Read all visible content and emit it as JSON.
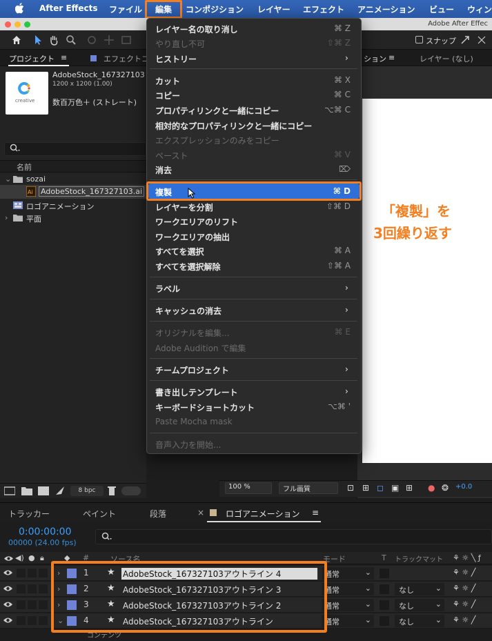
{
  "menubar": {
    "app_name": "After Effects",
    "items": [
      "ファイル",
      "編集",
      "コンポジション",
      "レイヤー",
      "エフェクト",
      "アニメーション",
      "ビュー",
      "ウィン"
    ]
  },
  "window": {
    "title": "Adobe After Effec"
  },
  "toolbar": {
    "snap_label": "スナップ"
  },
  "project_panel": {
    "tab_project": "プロジェクト",
    "tab_effect": "エフェクトコ",
    "tab_comp": "ション",
    "tab_layer": "レイヤー (なし)",
    "selected_file": "AdobeStock_167327103",
    "dimensions": "1200 x 1200 (1.00)",
    "color_info": "数百万色＋ (ストレート)",
    "thumbnail_text": "creative",
    "col_name": "名前",
    "items": [
      "sozai",
      "AdobeStock_167327103.ai",
      "ロゴアニメーション",
      "平面"
    ],
    "bpc": "8 bpc"
  },
  "comp_bar": {
    "zoom": "100 %",
    "quality": "フル画質",
    "exposure": "+0.0"
  },
  "edit_menu": {
    "groups": [
      [
        {
          "label": "レイヤー名の取り消し",
          "shortcut": "⌘ Z",
          "disabled": false
        },
        {
          "label": "やり直し不可",
          "shortcut": "⇧⌘ Z",
          "disabled": true
        },
        {
          "label": "ヒストリー",
          "shortcut": "",
          "disabled": false,
          "submenu": true
        }
      ],
      [
        {
          "label": "カット",
          "shortcut": "⌘ X",
          "disabled": false
        },
        {
          "label": "コピー",
          "shortcut": "⌘ C",
          "disabled": false
        },
        {
          "label": "プロパティリンクと一緒にコピー",
          "shortcut": "⌥⌘ C",
          "disabled": false
        },
        {
          "label": "相対的なプロパティリンクと一緒にコピー",
          "shortcut": "",
          "disabled": false
        },
        {
          "label": "エクスプレッションのみをコピー",
          "shortcut": "",
          "disabled": true
        },
        {
          "label": "ペースト",
          "shortcut": "⌘ V",
          "disabled": true
        },
        {
          "label": "消去",
          "shortcut": "⌦",
          "disabled": false
        }
      ],
      [
        {
          "label": "複製",
          "shortcut": "⌘ D",
          "disabled": false,
          "highlighted": true
        },
        {
          "label": "レイヤーを分割",
          "shortcut": "⇧⌘ D",
          "disabled": false
        },
        {
          "label": "ワークエリアのリフト",
          "shortcut": "",
          "disabled": false
        },
        {
          "label": "ワークエリアの抽出",
          "shortcut": "",
          "disabled": false
        },
        {
          "label": "すべてを選択",
          "shortcut": "⌘ A",
          "disabled": false
        },
        {
          "label": "すべてを選択解除",
          "shortcut": "⇧⌘ A",
          "disabled": false
        }
      ],
      [
        {
          "label": "ラベル",
          "shortcut": "",
          "disabled": false,
          "submenu": true
        }
      ],
      [
        {
          "label": "キャッシュの消去",
          "shortcut": "",
          "disabled": false,
          "submenu": true
        }
      ],
      [
        {
          "label": "オリジナルを編集...",
          "shortcut": "⌘ E",
          "disabled": true
        },
        {
          "label": "Adobe Audition で編集",
          "shortcut": "",
          "disabled": true
        }
      ],
      [
        {
          "label": "チームプロジェクト",
          "shortcut": "",
          "disabled": false,
          "submenu": true
        }
      ],
      [
        {
          "label": "書き出しテンプレート",
          "shortcut": "",
          "disabled": false,
          "submenu": true
        },
        {
          "label": "キーボードショートカット",
          "shortcut": "⌥⌘ '",
          "disabled": false
        },
        {
          "label": "Paste Mocha mask",
          "shortcut": "",
          "disabled": true
        }
      ],
      [
        {
          "label": "音声入力を開始...",
          "shortcut": "",
          "disabled": true
        }
      ]
    ]
  },
  "annotation": {
    "line1": "「複製」を",
    "line2": "3回繰り返す"
  },
  "timeline": {
    "tabs": [
      "トラッカー",
      "ペイント",
      "段落",
      "ロゴアニメーション"
    ],
    "timecode": "0:00:00:00",
    "fps": "00000 (24.00 fps)",
    "col_source": "ソース名",
    "col_mode": "モード",
    "col_t": "T",
    "col_trackmatte": "トラックマット",
    "col_num": "#",
    "layers": [
      {
        "num": "1",
        "name": "AdobeStock_167327103アウトライン 4",
        "mode": "通常",
        "matte": "",
        "expanded": false
      },
      {
        "num": "2",
        "name": "AdobeStock_167327103アウトライン 3",
        "mode": "通常",
        "matte": "なし",
        "expanded": false
      },
      {
        "num": "3",
        "name": "AdobeStock_167327103アウトライン 2",
        "mode": "通常",
        "matte": "なし",
        "expanded": false
      },
      {
        "num": "4",
        "name": "AdobeStock_167327103アウトライン",
        "mode": "通常",
        "matte": "なし",
        "expanded": true
      }
    ],
    "contents_label": "コンテンツ"
  },
  "colors": {
    "accent_orange": "#f47f20",
    "menu_highlight": "#2f6fd8",
    "menubar_blue": "#2a58a6",
    "label_blue": "#6f84d8",
    "timecode_blue": "#3aa0ff"
  }
}
